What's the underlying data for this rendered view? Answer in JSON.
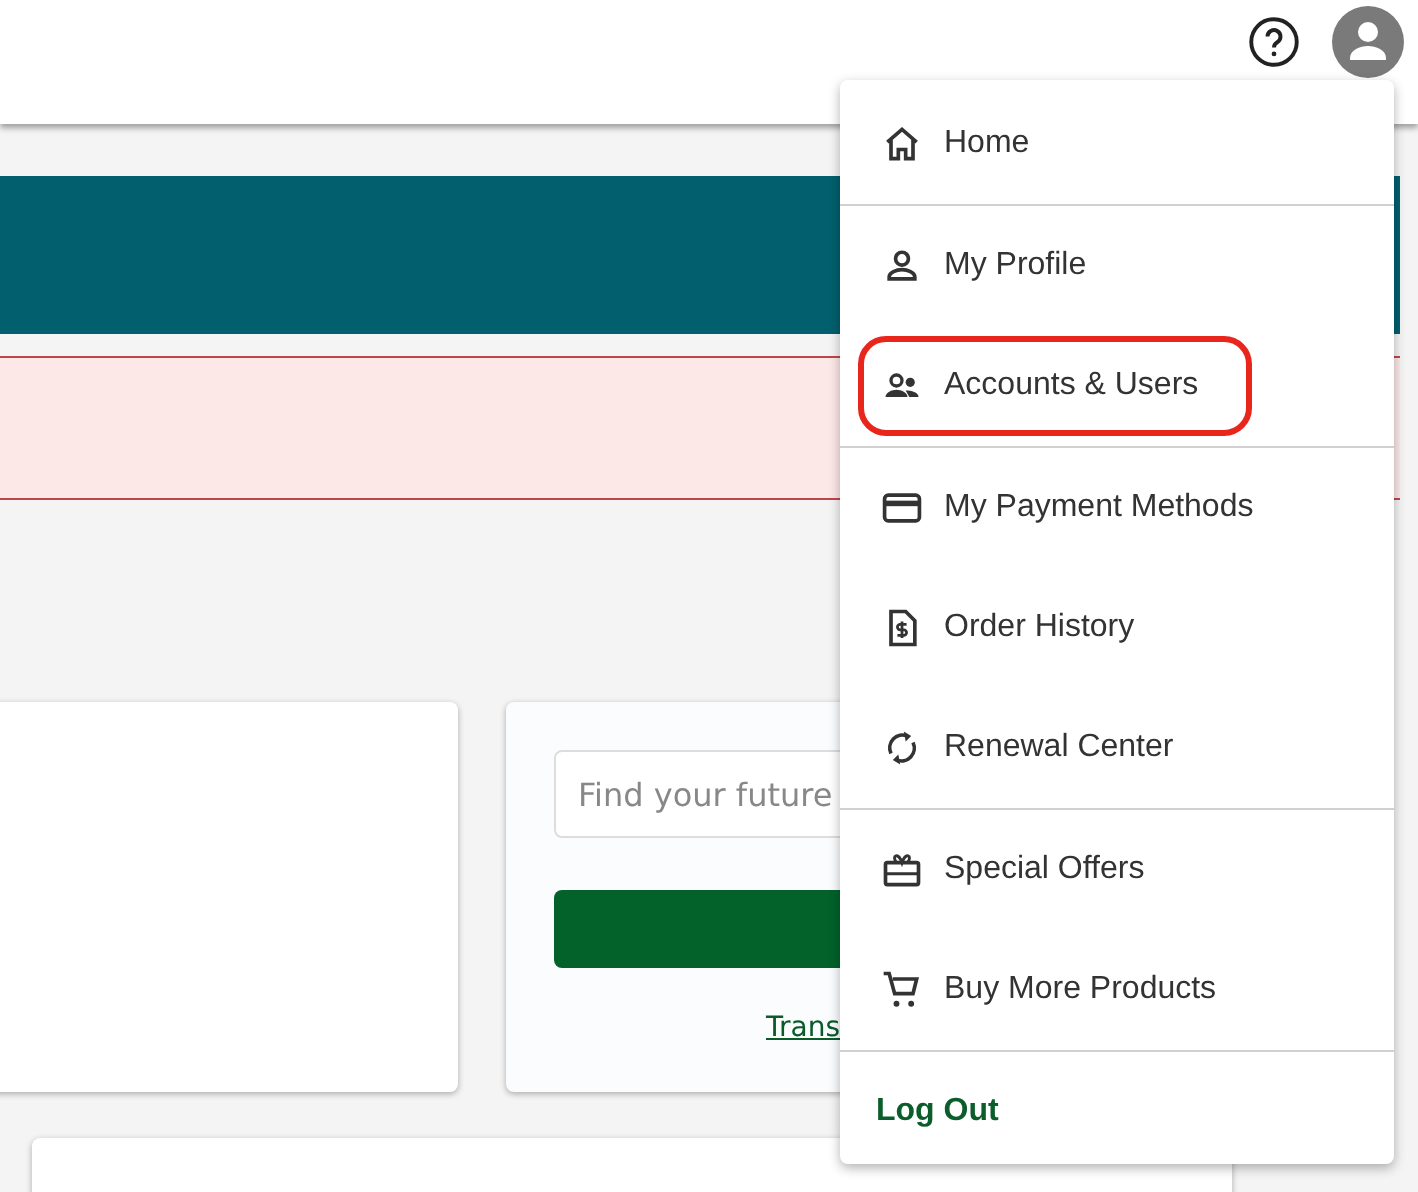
{
  "search": {
    "placeholder": "Find your future"
  },
  "link": "Trans",
  "menu": {
    "groups": [
      [
        {
          "kind": "home",
          "label": "Home",
          "highlighted": false
        }
      ],
      [
        {
          "kind": "profile",
          "label": "My Profile",
          "highlighted": false
        },
        {
          "kind": "users",
          "label": "Accounts & Users",
          "highlighted": true
        }
      ],
      [
        {
          "kind": "card",
          "label": "My Payment Methods",
          "highlighted": false
        },
        {
          "kind": "invoice",
          "label": "Order History",
          "highlighted": false
        },
        {
          "kind": "renew",
          "label": "Renewal Center",
          "highlighted": false
        }
      ],
      [
        {
          "kind": "gift",
          "label": "Special Offers",
          "highlighted": false
        },
        {
          "kind": "cart",
          "label": "Buy More Products",
          "highlighted": false
        }
      ],
      [
        {
          "kind": "logout",
          "label": "Log Out",
          "highlighted": false
        }
      ]
    ]
  }
}
